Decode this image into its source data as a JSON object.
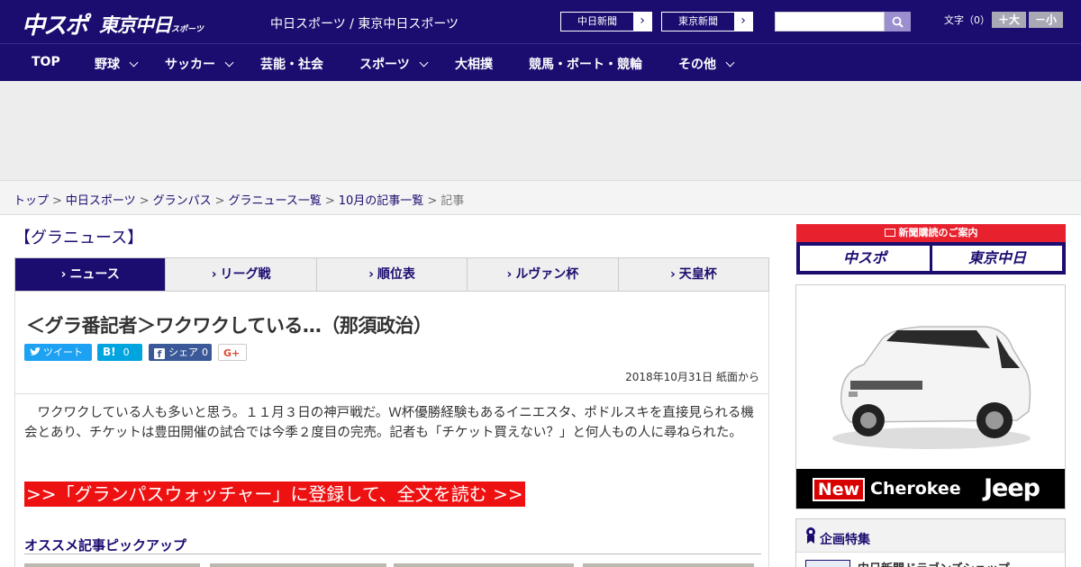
{
  "header": {
    "logo_chunichi": "中スポ",
    "logo_tokyo": "東京中日",
    "logo_tokyo_small": "スポーツ",
    "site_links": "中日スポーツ / 東京中日スポーツ",
    "paper_buttons": [
      "中日新聞",
      "東京新聞"
    ],
    "search_placeholder": "",
    "font_size_label": "文字（0）",
    "font_larger": "＋大",
    "font_smaller": "－小"
  },
  "nav": {
    "items": [
      {
        "label": "TOP"
      },
      {
        "label": "野球"
      },
      {
        "label": "サッカー"
      },
      {
        "label": "芸能・社会"
      },
      {
        "label": "スポーツ"
      },
      {
        "label": "大相撲"
      },
      {
        "label": "競馬・ボート・競輪"
      },
      {
        "label": "その他"
      }
    ]
  },
  "breadcrumb": {
    "items": [
      "トップ",
      "中日スポーツ",
      "グランパス",
      "グラニュース一覧",
      "10月の記事一覧"
    ],
    "current": "記事"
  },
  "section_title": "【グラニュース】",
  "tabs": [
    "ニュース",
    "リーグ戦",
    "順位表",
    "ルヴァン杯",
    "天皇杯"
  ],
  "article": {
    "headline": "＜グラ番記者＞ワクワクしている…（那須政治）",
    "share": {
      "tweet": "ツイート",
      "hatena_count": "0",
      "fb_label": "シェア",
      "fb_count": "0",
      "gplus": "G+"
    },
    "date": "2018年10月31日 紙面から",
    "body": "ワクワクしている人も多いと思う。１１月３日の神戸戦だ。Ｗ杯優勝経験もあるイニエスタ、ポドルスキを直接見られる機会とあり、チケットは豊田開催の試合では今季２度目の完売。記者も「チケット買えない？」と何人もの人に尋ねられた。",
    "cta": ">>「グランパスウォッチャー」に登録して、全文を読む >>"
  },
  "pickup": {
    "title": "オススメ記事ピックアップ"
  },
  "sidebar": {
    "subscribe_title": "新聞購読のご案内",
    "sub_buttons": [
      "中スポ",
      "東京中日"
    ],
    "car_ad": {
      "new_label": "New",
      "model": "Cherokee",
      "brand": "Jeep"
    },
    "kikaku_title": "企画特集",
    "kikaku_item": "中日新聞ドラゴンズショップ"
  },
  "colors": {
    "brand": "#1b0d70",
    "cta": "#ee1111",
    "twitter": "#1da1f2",
    "hatena": "#00a4de",
    "facebook": "#3b5998"
  }
}
